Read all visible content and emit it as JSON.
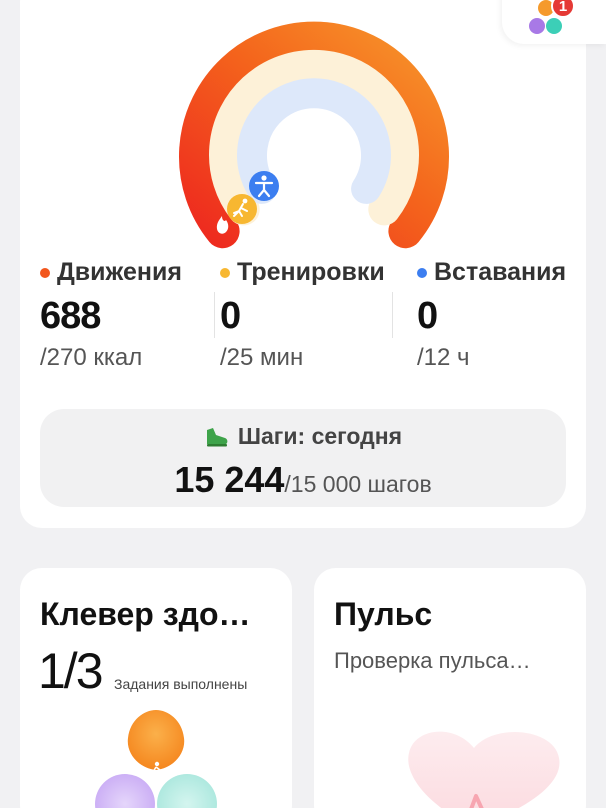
{
  "app_badge": {
    "count": "1",
    "icon": "health-app-icon"
  },
  "rings": {
    "move": {
      "progress": 1.0,
      "color": "#f2561d"
    },
    "exercise": {
      "progress": 0.0,
      "color": "#f7b731"
    },
    "stand": {
      "progress": 0.0,
      "color": "#3c7ef0"
    }
  },
  "stats": [
    {
      "label": "Движения",
      "value": "688",
      "goal": "/270 ккал",
      "color": "#f2561d"
    },
    {
      "label": "Тренировки",
      "value": "0",
      "goal": "/25 мин",
      "color": "#f7b731"
    },
    {
      "label": "Вставания",
      "value": "0",
      "goal": "/12 ч",
      "color": "#3c7ef0"
    }
  ],
  "steps": {
    "title": "Шаги: сегодня",
    "value": "15 244",
    "goal": "/15 000 шагов",
    "icon_color": "#3ea34a"
  },
  "clover": {
    "title": "Клевер здо…",
    "count": "1/3",
    "description": "Задания выполнены"
  },
  "pulse": {
    "title": "Пульс",
    "subtitle": "Проверка пульса…"
  }
}
